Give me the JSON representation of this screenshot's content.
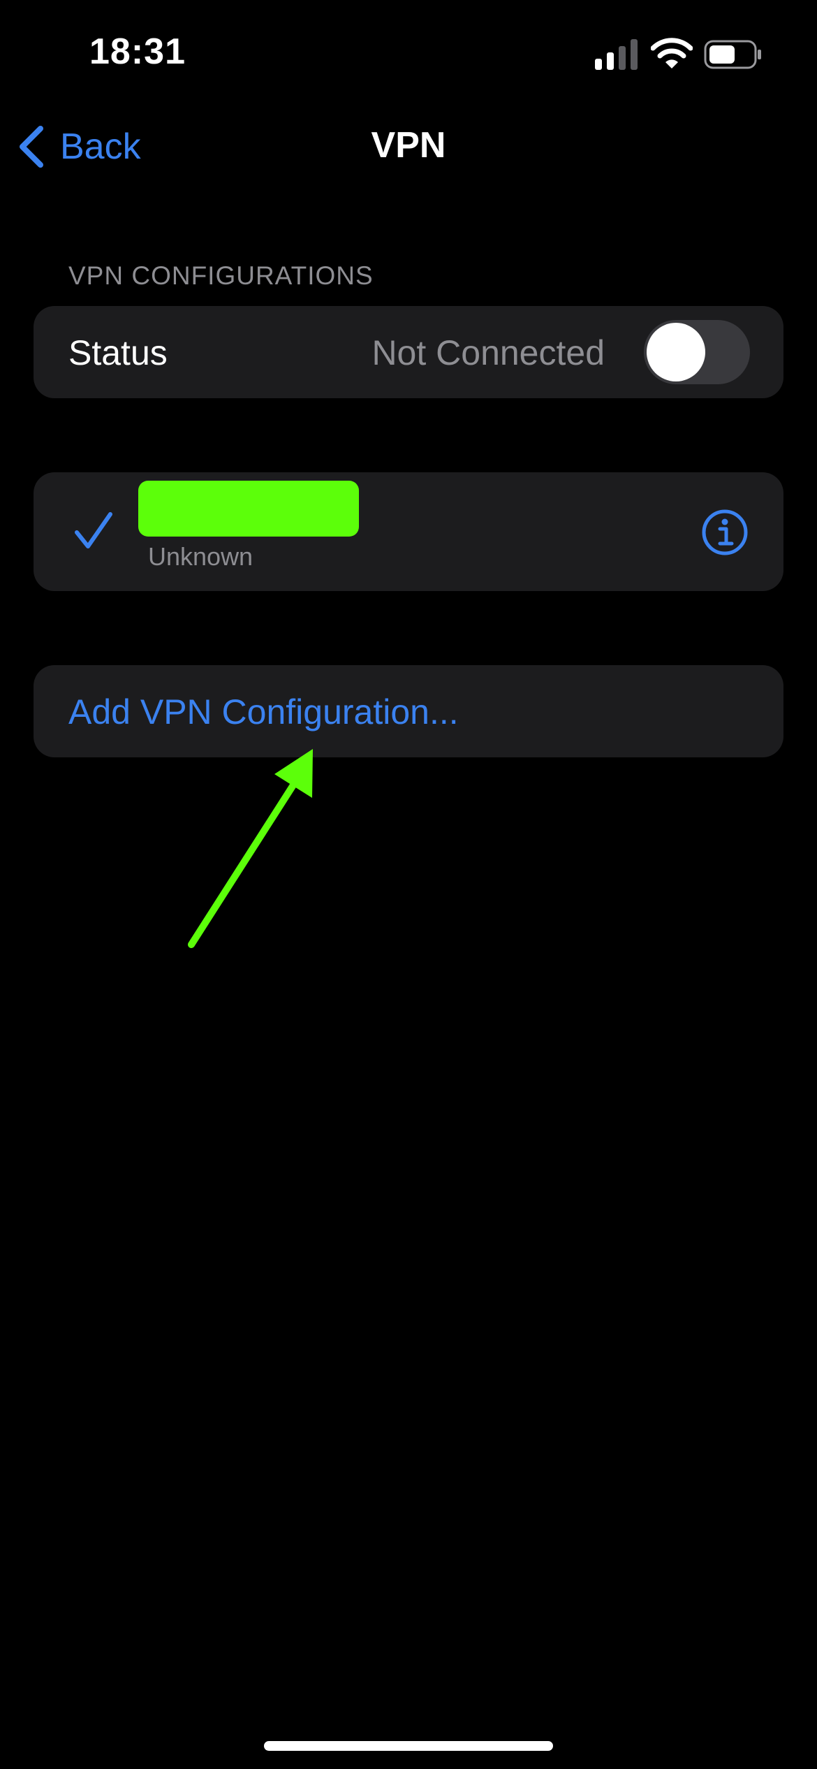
{
  "status_bar": {
    "time": "18:31",
    "icons": [
      "cellular-signal-icon",
      "wifi-icon",
      "battery-icon"
    ]
  },
  "nav": {
    "back_label": "Back",
    "title": "VPN"
  },
  "section_header": "VPN CONFIGURATIONS",
  "status_row": {
    "label": "Status",
    "value": "Not Connected",
    "toggle_on": false
  },
  "config_row": {
    "selected": true,
    "name_redacted": true,
    "subtitle": "Unknown",
    "icons": [
      "checkmark-icon",
      "info-icon"
    ]
  },
  "add_row": {
    "label": "Add VPN Configuration..."
  },
  "colors": {
    "background": "#000000",
    "cell_background": "#1c1c1e",
    "accent": "#3b82f0",
    "secondary_text": "#8e8e93",
    "annotation": "#5cff0a"
  }
}
